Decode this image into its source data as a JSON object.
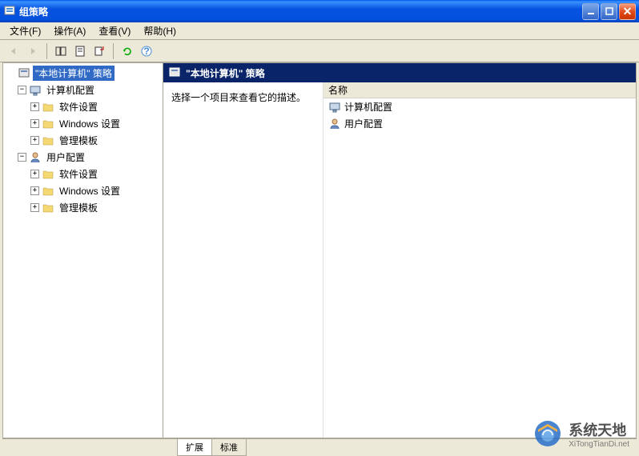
{
  "window": {
    "title": "组策略"
  },
  "menu": {
    "file": "文件(F)",
    "action": "操作(A)",
    "view": "查看(V)",
    "help": "帮助(H)"
  },
  "tree": {
    "root": {
      "label": "\"本地计算机\" 策略"
    },
    "computer_config": {
      "label": "计算机配置"
    },
    "computer_software": {
      "label": "软件设置"
    },
    "computer_windows": {
      "label": "Windows 设置"
    },
    "computer_templates": {
      "label": "管理模板"
    },
    "user_config": {
      "label": "用户配置"
    },
    "user_software": {
      "label": "软件设置"
    },
    "user_windows": {
      "label": "Windows 设置"
    },
    "user_templates": {
      "label": "管理模板"
    }
  },
  "right": {
    "header": "\"本地计算机\" 策略",
    "description": "选择一个项目来查看它的描述。",
    "column_name": "名称",
    "items": {
      "computer": "计算机配置",
      "user": "用户配置"
    }
  },
  "tabs": {
    "extended": "扩展",
    "standard": "标准"
  },
  "watermark": {
    "brand": "系统天地",
    "url": "XiTongTianDi.net"
  }
}
